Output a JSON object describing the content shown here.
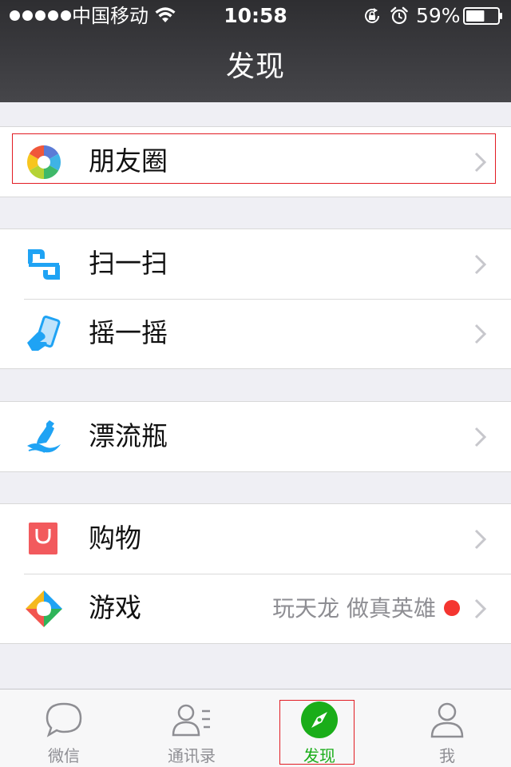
{
  "status_bar": {
    "carrier": "中国移动",
    "time": "10:58",
    "battery": "59%",
    "battery_level": 0.59,
    "icons": [
      "signal-dots",
      "wifi-icon",
      "rotation-lock-icon",
      "alarm-icon",
      "battery-icon"
    ]
  },
  "nav": {
    "title": "发现"
  },
  "groups": [
    {
      "items": [
        {
          "label": "朋友圈",
          "icon": "moments-icon"
        }
      ]
    },
    {
      "items": [
        {
          "label": "扫一扫",
          "icon": "scan-icon"
        },
        {
          "label": "摇一摇",
          "icon": "shake-icon"
        }
      ]
    },
    {
      "items": [
        {
          "label": "漂流瓶",
          "icon": "drift-bottle-icon"
        }
      ]
    },
    {
      "items": [
        {
          "label": "购物",
          "icon": "shopping-bag-icon"
        },
        {
          "label": "游戏",
          "icon": "games-icon",
          "detail": "玩天龙 做真英雄",
          "badge": "red-dot"
        }
      ]
    }
  ],
  "tabs": [
    {
      "label": "微信",
      "icon": "chat-bubble-icon",
      "active": false
    },
    {
      "label": "通讯录",
      "icon": "contacts-icon",
      "active": false
    },
    {
      "label": "发现",
      "icon": "compass-icon",
      "active": true
    },
    {
      "label": "我",
      "icon": "profile-icon",
      "active": false
    }
  ],
  "colors": {
    "nav_background": "#3b3b3f",
    "active_tab": "#1aad19",
    "highlight_border": "#e21b23",
    "badge": "#f43530",
    "page_background": "#efeff4"
  }
}
